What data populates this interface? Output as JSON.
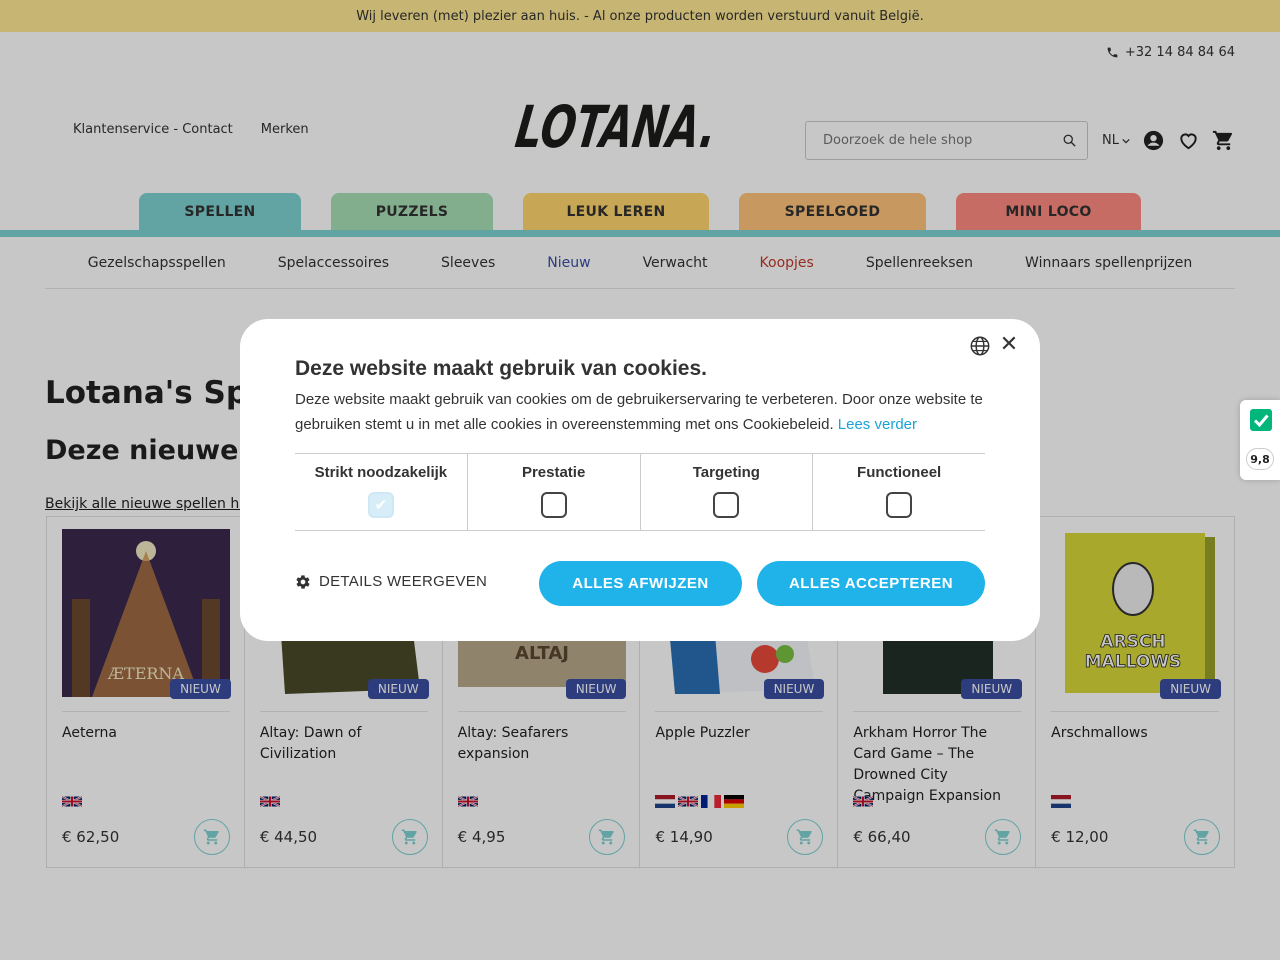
{
  "topbar": {
    "text": "Wij leveren (met) plezier aan huis. - Al onze producten worden verstuurd vanuit België."
  },
  "header": {
    "phone": "+32 14 84 84 64",
    "links": [
      "Klantenservice - Contact",
      "Merken"
    ],
    "logo_text": "LOTANA.",
    "search_placeholder": "Doorzoek de hele shop",
    "lang": "NL"
  },
  "categories": [
    {
      "label": "SPELLEN",
      "color": "#7ed1d2"
    },
    {
      "label": "PUZZELS",
      "color": "#a7dfb5"
    },
    {
      "label": "LEUK LEREN",
      "color": "#ffd76f"
    },
    {
      "label": "SPEELGOED",
      "color": "#ffc37a"
    },
    {
      "label": "MINI LOCO",
      "color": "#ff8b80"
    }
  ],
  "subnav": [
    {
      "label": "Gezelschapsspellen",
      "color": "#333333"
    },
    {
      "label": "Spelaccessoires",
      "color": "#333333"
    },
    {
      "label": "Sleeves",
      "color": "#333333"
    },
    {
      "label": "Nieuw",
      "color": "#3a4ea1"
    },
    {
      "label": "Verwacht",
      "color": "#333333"
    },
    {
      "label": "Koopjes",
      "color": "#c0392b"
    },
    {
      "label": "Spellenreeksen",
      "color": "#333333"
    },
    {
      "label": "Winnaars spellenprijzen",
      "color": "#333333"
    }
  ],
  "page": {
    "title": "Lotana's Spel",
    "subtitle": "Deze nieuwe bo",
    "link": "Bekijk alle nieuwe spellen hier:"
  },
  "products": [
    {
      "name": "Aeterna",
      "badge": "NIEUW",
      "price": "€ 62,50",
      "flags": [
        "gb"
      ]
    },
    {
      "name": "Altay: Dawn of Civilization",
      "badge": "NIEUW",
      "price": "€ 44,50",
      "flags": [
        "gb"
      ]
    },
    {
      "name": "Altay: Seafarers expansion",
      "badge": "NIEUW",
      "price": "€ 4,95",
      "flags": [
        "gb"
      ]
    },
    {
      "name": "Apple Puzzler",
      "badge": "NIEUW",
      "price": "€ 14,90",
      "flags": [
        "nl",
        "gb",
        "fr",
        "de"
      ]
    },
    {
      "name": "Arkham Horror The Card Game – The Drowned City Campaign Expansion",
      "badge": "NIEUW",
      "price": "€ 66,40",
      "flags": [
        "gb"
      ]
    },
    {
      "name": "Arschmallows",
      "badge": "NIEUW",
      "price": "€ 12,00",
      "flags": [
        "nl"
      ]
    }
  ],
  "rating": {
    "score": "9,8"
  },
  "cookie_modal": {
    "title": "Deze website maakt gebruik van cookies.",
    "text": "Deze website maakt gebruik van cookies om de gebruikerservaring te verbeteren. Door onze website te gebruiken stemt u in met alle cookies in overeenstemming met ons Cookiebeleid.",
    "more": "Lees verder",
    "categories": [
      {
        "label": "Strikt noodzakelijk",
        "checked": true
      },
      {
        "label": "Prestatie",
        "checked": false
      },
      {
        "label": "Targeting",
        "checked": false
      },
      {
        "label": "Functioneel",
        "checked": false
      }
    ],
    "details": "DETAILS WEERGEVEN",
    "reject": "ALLES AFWIJZEN",
    "accept": "ALLES ACCEPTEREN",
    "close": "✕"
  }
}
